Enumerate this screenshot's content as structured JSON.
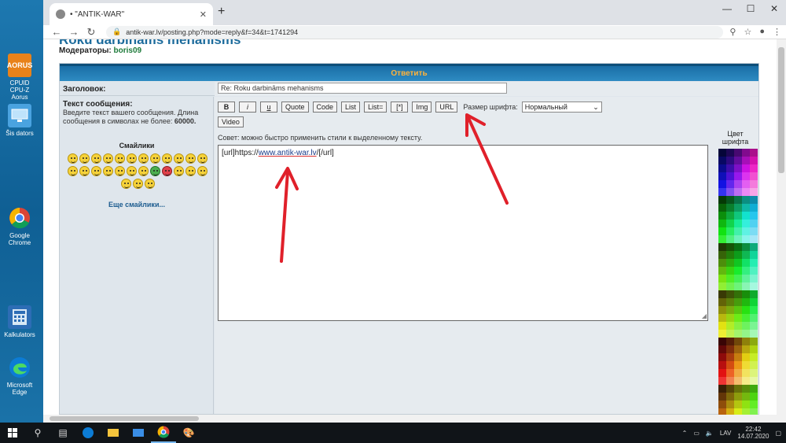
{
  "desktop": {
    "icons": [
      {
        "label": "CPUID CPU-Z Aorus",
        "badge": "AORUS"
      },
      {
        "label": "Šis dators"
      },
      {
        "label": "Google Chrome"
      },
      {
        "label": "Kalkulators"
      },
      {
        "label": "Microsoft Edge"
      }
    ]
  },
  "browser": {
    "tab_title": "• \"ANTIK-WAR\"",
    "url": "antik-war.lv/posting.php?mode=reply&f=34&t=1741294"
  },
  "page": {
    "topic_title": "Roku darbināms mehanisms",
    "moderators_label": "Модераторы:",
    "moderator_name": "boris09",
    "form_header": "Ответить",
    "subject_label": "Заголовок:",
    "subject_value": "Re: Roku darbināms mehanisms",
    "message_label": "Текст сообщения:",
    "message_hint_a": "Введите текст вашего сообщения. Длина сообщения в символах не более:",
    "message_hint_b": "60000.",
    "smilies_title": "Смайлики",
    "more_smilies": "Еще смайлики...",
    "toolbar": {
      "bold": "B",
      "italic": "i",
      "underline": "u",
      "quote": "Quote",
      "code": "Code",
      "list": "List",
      "list_ordered": "List=",
      "list_item": "[*]",
      "img": "Img",
      "url": "URL",
      "video": "Video",
      "fontsize_label": "Размер шрифта:",
      "fontsize_value": "Нормальный"
    },
    "tip": "Совет: можно быстро применить стили к выделенному тексту.",
    "message_parts": {
      "open": "[url]",
      "scheme": "https://",
      "domain": "www.antik-war.lv",
      "close": "/[/url]"
    },
    "palette_title": "Цвет шрифта"
  },
  "taskbar": {
    "language": "LAV",
    "time": "22:42",
    "date": "14.07.2020"
  },
  "colors": {
    "header_blue": "#1a6ea6",
    "header_text": "#ffb33b",
    "annotation_arrow": "#e0202a"
  }
}
